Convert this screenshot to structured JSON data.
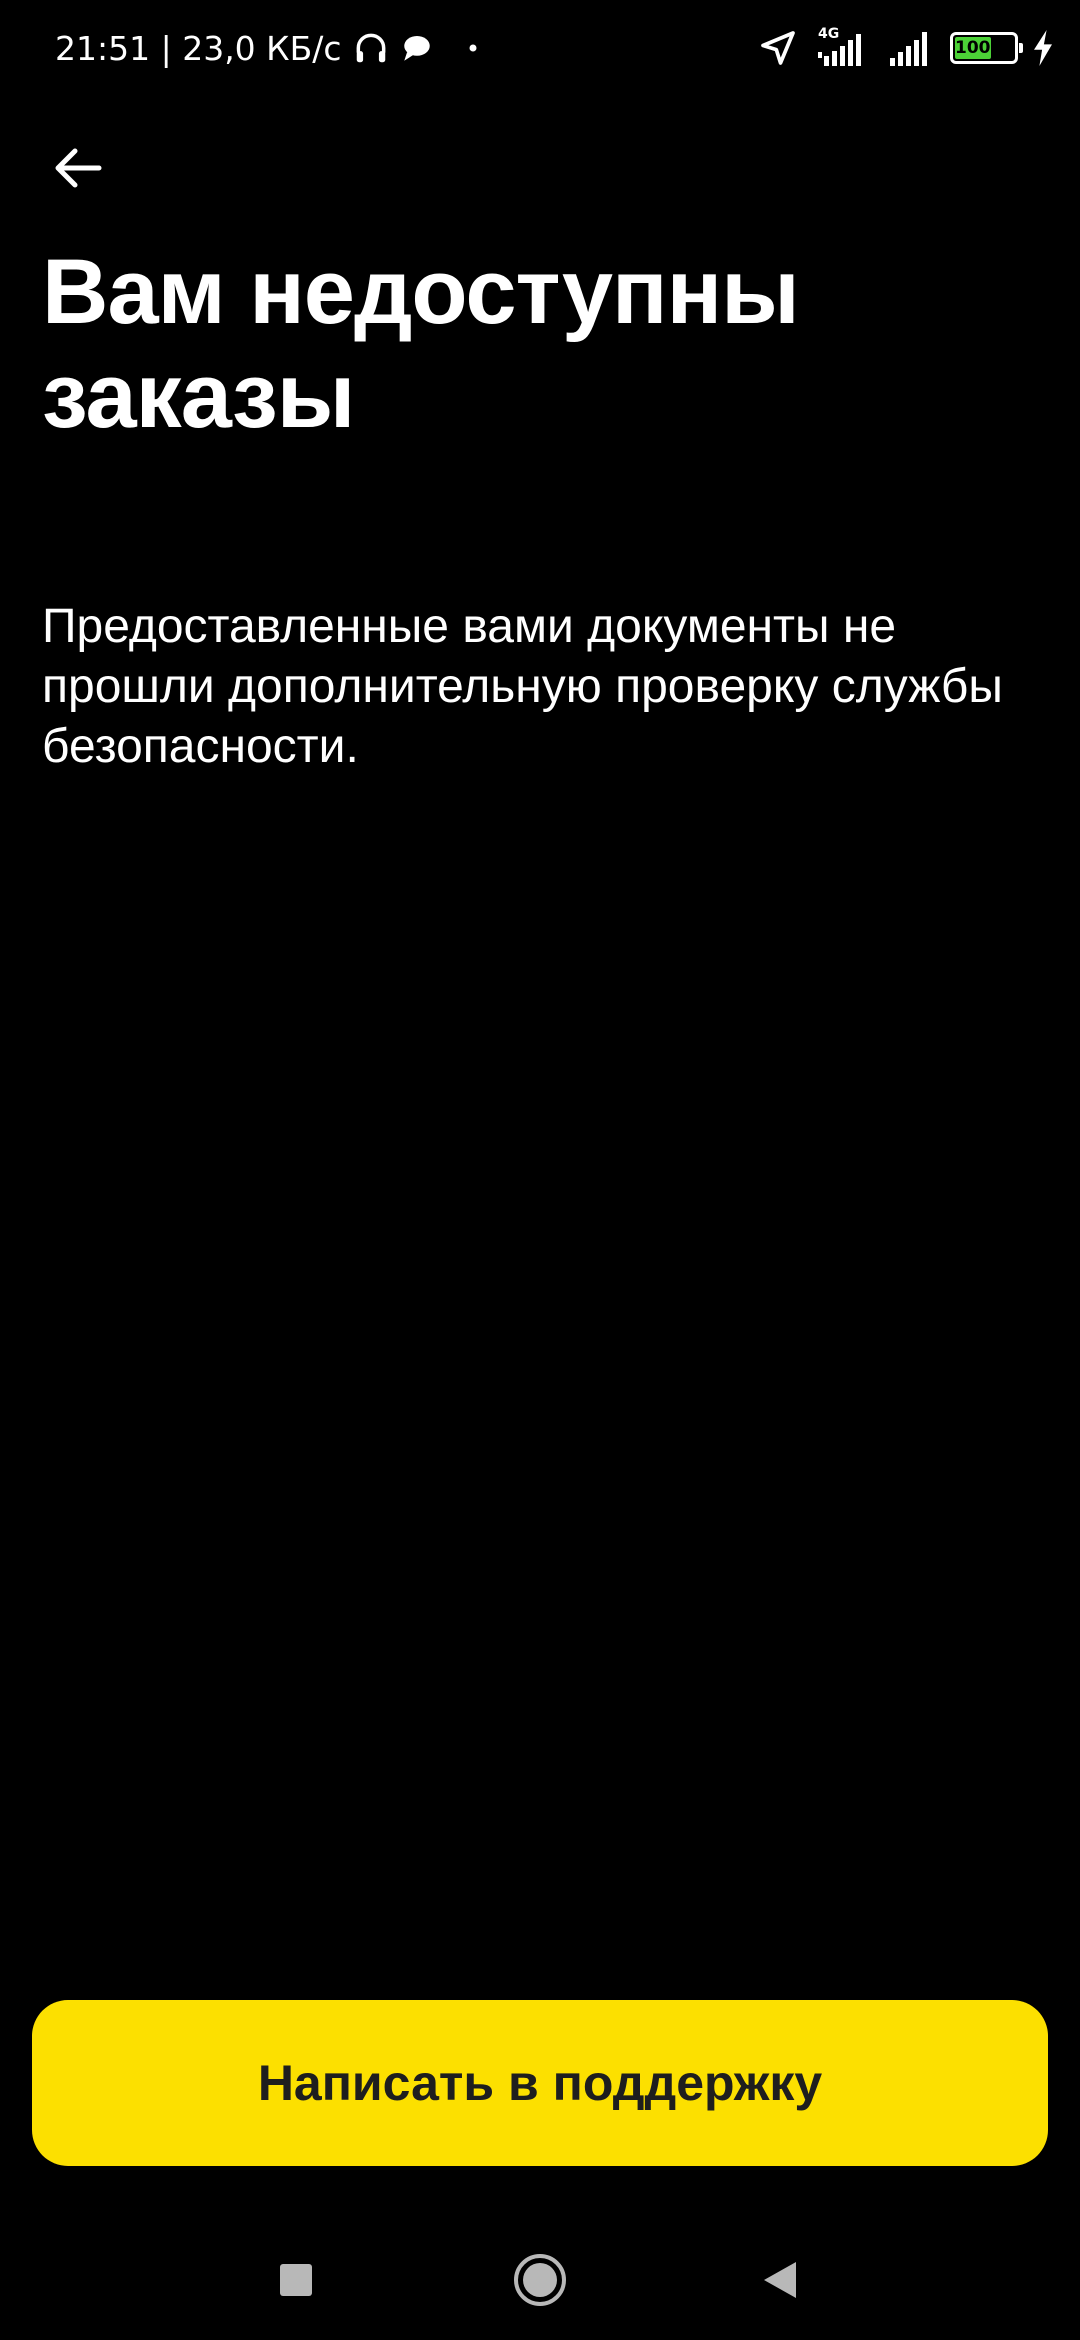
{
  "status_bar": {
    "left_text": "21:51 | 23,0 КБ/с",
    "network_label": "4G",
    "battery_level": "100",
    "battery_color": "#4cd137",
    "icons": [
      "headphones-icon",
      "chat-bubble-icon",
      "dot-icon",
      "location-arrow-icon",
      "signal-icon",
      "signal-icon",
      "battery-icon",
      "charging-icon"
    ]
  },
  "header": {
    "back_icon": "arrow-left-icon"
  },
  "main": {
    "title": "Вам недоступны заказы",
    "description": "Предоставленные вами документы не прошли дополнительную проверку службы безопасности."
  },
  "actions": {
    "support_label": "Написать в поддержку",
    "support_color": "#fce000"
  },
  "nav_bar": {
    "icons": [
      "recents-icon",
      "home-icon",
      "back-triangle-icon"
    ]
  }
}
